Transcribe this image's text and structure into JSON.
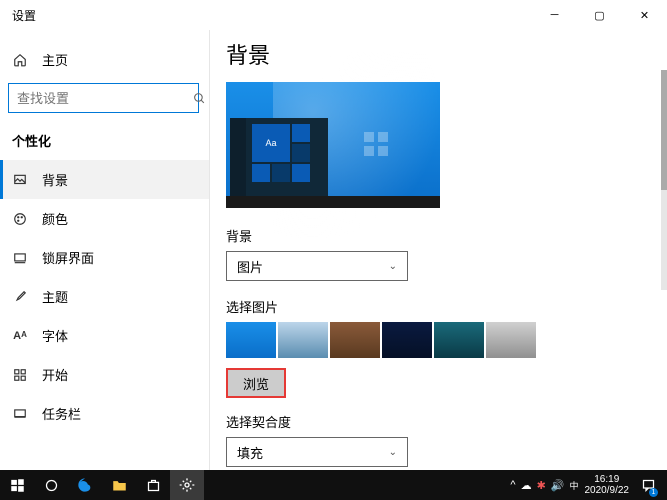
{
  "titlebar": {
    "title": "设置"
  },
  "sidebar": {
    "home_label": "主页",
    "search_placeholder": "查找设置",
    "section_label": "个性化",
    "items": [
      {
        "label": "背景",
        "icon": "image"
      },
      {
        "label": "颜色",
        "icon": "palette"
      },
      {
        "label": "锁屏界面",
        "icon": "lock"
      },
      {
        "label": "主题",
        "icon": "brush"
      },
      {
        "label": "字体",
        "icon": "font"
      },
      {
        "label": "开始",
        "icon": "grid"
      },
      {
        "label": "任务栏",
        "icon": "taskbar"
      }
    ]
  },
  "content": {
    "heading": "背景",
    "preview_tile_text": "Aa",
    "bg_label": "背景",
    "bg_value": "图片",
    "pick_label": "选择图片",
    "browse_label": "浏览",
    "fit_label": "选择契合度",
    "fit_value": "填充"
  },
  "taskbar": {
    "clock_time": "16:19",
    "clock_date": "2020/9/22",
    "notif_count": "1"
  }
}
